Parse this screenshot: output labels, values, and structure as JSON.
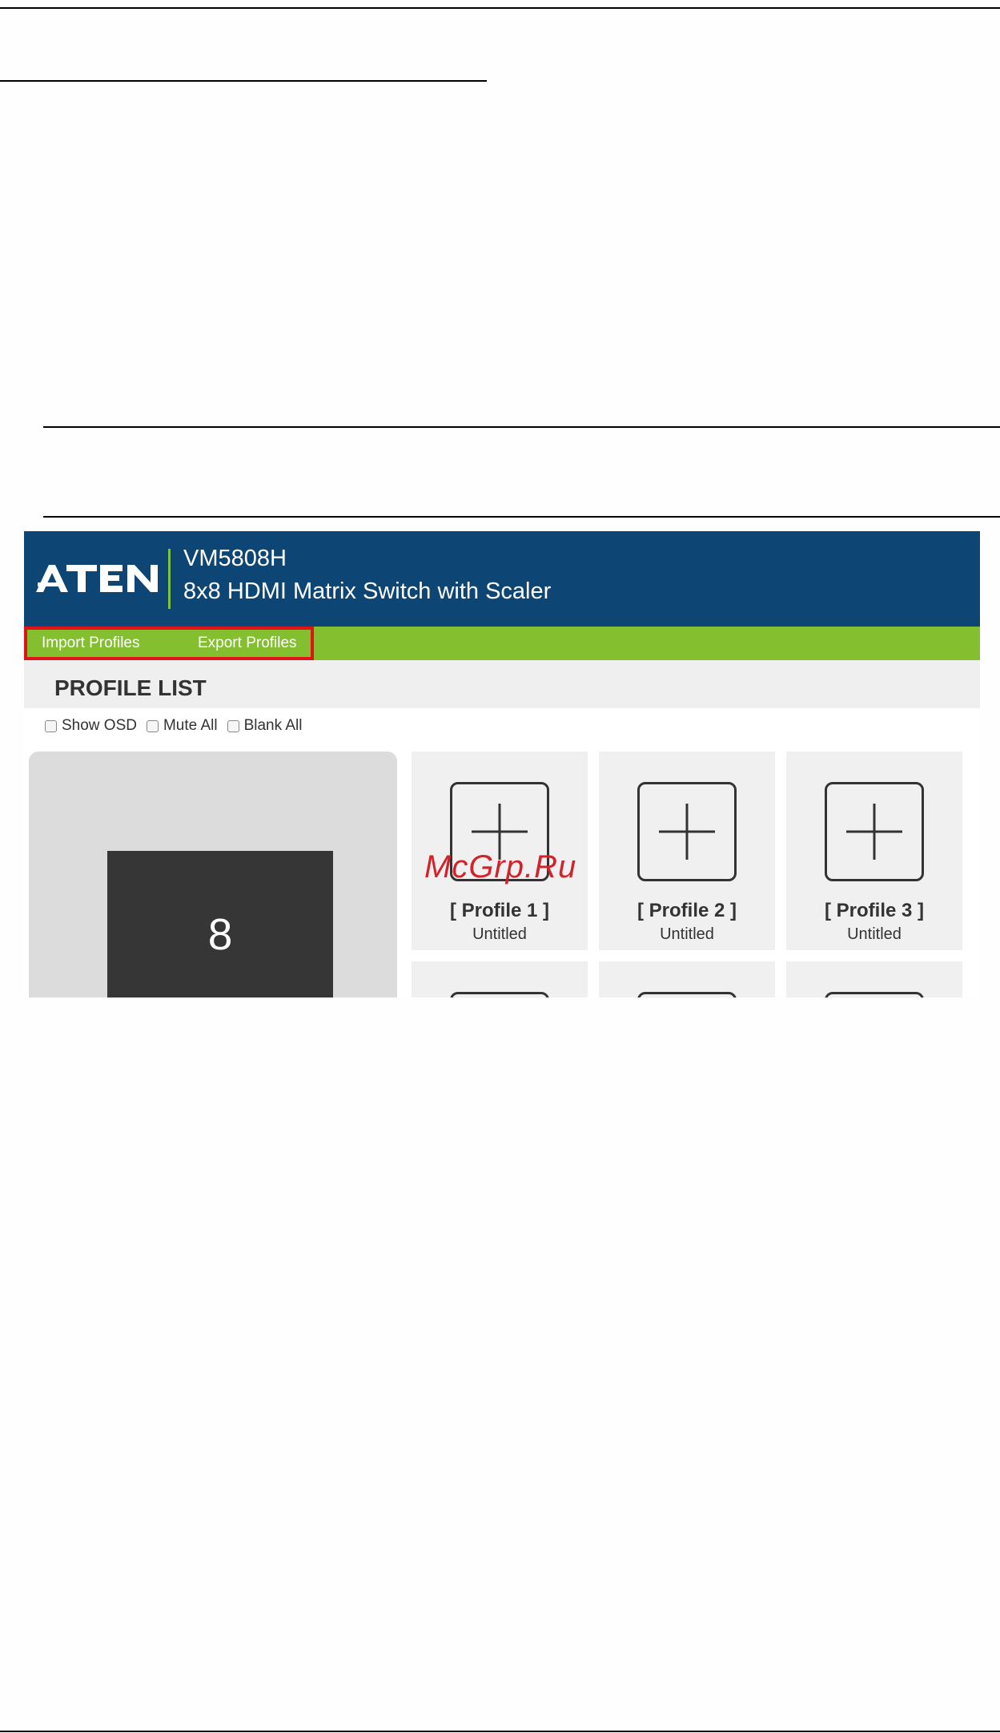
{
  "header": {
    "logo_text": "ATEN",
    "model": "VM5808H",
    "subtitle": "8x8 HDMI Matrix Switch with Scaler"
  },
  "menu": {
    "import_label": "Import Profiles",
    "export_label": "Export Profiles"
  },
  "profile_list": {
    "title": "PROFILE LIST",
    "options": [
      {
        "label": "Show OSD",
        "checked": false
      },
      {
        "label": "Mute All",
        "checked": false
      },
      {
        "label": "Blank All",
        "checked": false
      }
    ],
    "preview_number": "8",
    "profiles": [
      {
        "name": "[ Profile 1 ]",
        "state": "Untitled"
      },
      {
        "name": "[ Profile 2 ]",
        "state": "Untitled"
      },
      {
        "name": "[ Profile 3 ]",
        "state": "Untitled"
      }
    ]
  },
  "watermark": "McGrp.Ru",
  "colors": {
    "header_bg": "#0d4574",
    "menu_bg": "#84bf2f",
    "highlight_border": "#e0131a",
    "accent_divider": "#7ec242",
    "card_bg": "#f0f0f0",
    "preview_bg": "#dcdcdc",
    "preview_screen": "#363636"
  }
}
